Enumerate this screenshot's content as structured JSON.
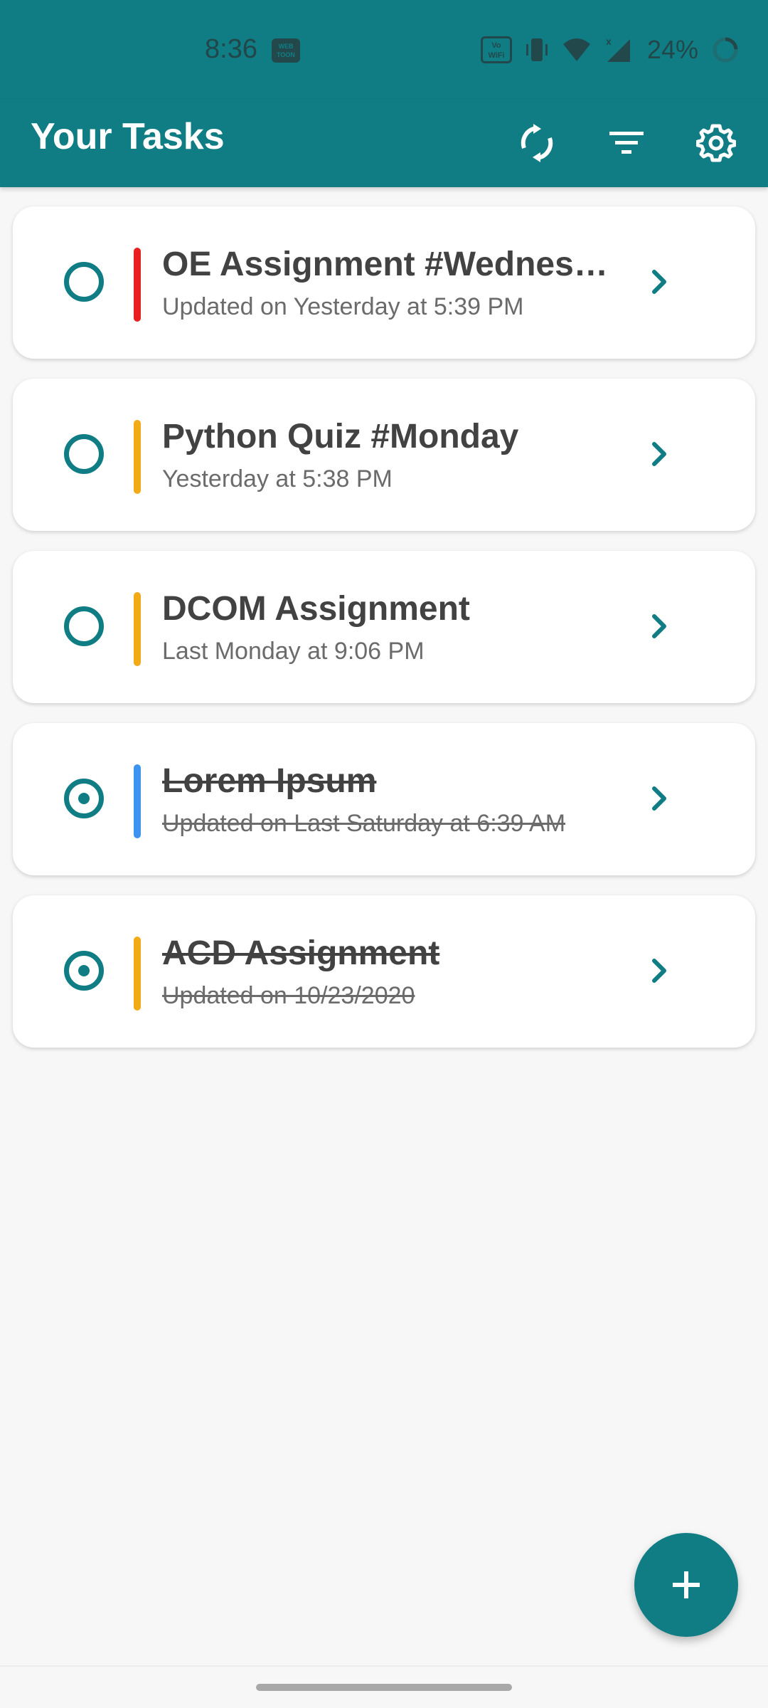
{
  "status_bar": {
    "time": "8:36",
    "app_icon_text": "WEB TOON",
    "volte_text": "Vo WiFi",
    "battery_percent": "24%",
    "battery_level": 0.24,
    "icons": [
      "webtoon-icon",
      "vowifi-icon",
      "vibrate-icon",
      "wifi-icon",
      "signal-icon",
      "battery-ring-icon"
    ]
  },
  "app_bar": {
    "title": "Your Tasks",
    "actions": [
      "sync-icon",
      "filter-icon",
      "gear-icon"
    ]
  },
  "tasks": [
    {
      "title": "OE Assignment #Wednesday",
      "subtitle": "Updated on Yesterday at 5:39 PM",
      "color": "#e8201f",
      "done": false
    },
    {
      "title": "Python Quiz #Monday",
      "subtitle": "Yesterday at 5:38 PM",
      "color": "#f2ab16",
      "done": false
    },
    {
      "title": "DCOM Assignment",
      "subtitle": "Last Monday at 9:06 PM",
      "color": "#f2ab16",
      "done": false
    },
    {
      "title": "Lorem Ipsum",
      "subtitle": "Updated on Last Saturday at 6:39 AM",
      "color": "#3d93f0",
      "done": true
    },
    {
      "title": "ACD Assignment",
      "subtitle": "Updated on 10/23/2020",
      "color": "#f2ab16",
      "done": true
    }
  ],
  "fab": {
    "icon": "plus-icon"
  },
  "colors": {
    "primary": "#107d84",
    "background": "#f7f7f7"
  }
}
